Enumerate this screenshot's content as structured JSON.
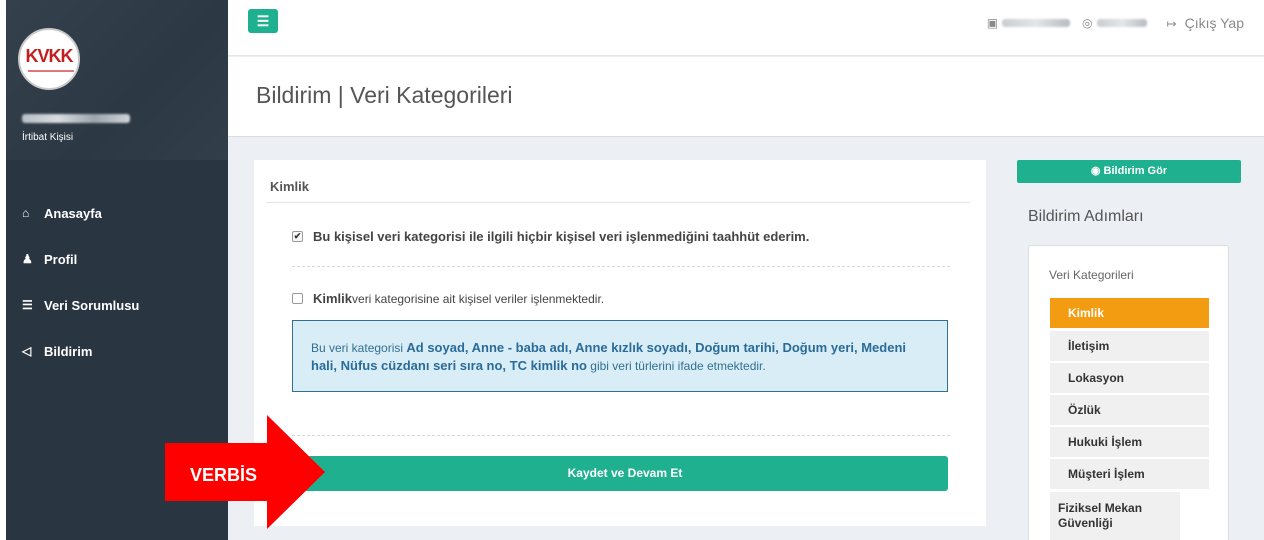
{
  "sidebar": {
    "logo_text": "KVKK",
    "role": "İrtibat Kişisi",
    "items": [
      {
        "label": "Anasayfa",
        "icon": "home-icon",
        "glyph": "🏠︎"
      },
      {
        "label": "Profil",
        "icon": "user-icon",
        "glyph": "♟"
      },
      {
        "label": "Veri Sorumlusu",
        "icon": "database-icon",
        "glyph": "☰"
      },
      {
        "label": "Bildirim",
        "icon": "bullhorn-icon",
        "glyph": "📢︎"
      }
    ]
  },
  "header": {
    "menu_icon": "☰",
    "logout_label": "Çıkış Yap"
  },
  "page": {
    "title": "Bildirim | Veri Kategorileri"
  },
  "panel": {
    "title": "Kimlik",
    "commit_label": "Bu kişisel veri kategorisi ile ilgili hiçbir kişisel veri işlenmediğini taahhüt ederim.",
    "commit_checked": true,
    "process_bold": "Kimlik",
    "process_label": " veri kategorisine ait kişisel veriler işlenmektedir.",
    "process_checked": false,
    "info_prefix": "Bu veri kategorisi ",
    "info_items": "Ad soyad, Anne - baba adı, Anne kızlık soyadı, Doğum tarihi, Doğum yeri, Medeni hali, Nüfus cüzdanı seri sıra no, TC kimlik no",
    "info_suffix": " gibi veri türlerini ifade etmektedir.",
    "save_label": "Kaydet ve Devam Et"
  },
  "right": {
    "view_label": "Bildirim Gör",
    "steps_title": "Bildirim Adımları",
    "steps_sub": "Veri Kategorileri",
    "steps": [
      {
        "label": "Kimlik",
        "active": true
      },
      {
        "label": "İletişim",
        "active": false
      },
      {
        "label": "Lokasyon",
        "active": false
      },
      {
        "label": "Özlük",
        "active": false
      },
      {
        "label": "Hukuki İşlem",
        "active": false
      },
      {
        "label": "Müşteri İşlem",
        "active": false
      },
      {
        "label": "Fiziksel Mekan Güvenliği",
        "active": false
      }
    ]
  },
  "overlay": {
    "arrow_label": "VERBİS",
    "arrow_color": "#ff0000"
  },
  "colors": {
    "accent": "#1fb18f",
    "active_step": "#f39c12",
    "sidebar": "#2a3542"
  }
}
